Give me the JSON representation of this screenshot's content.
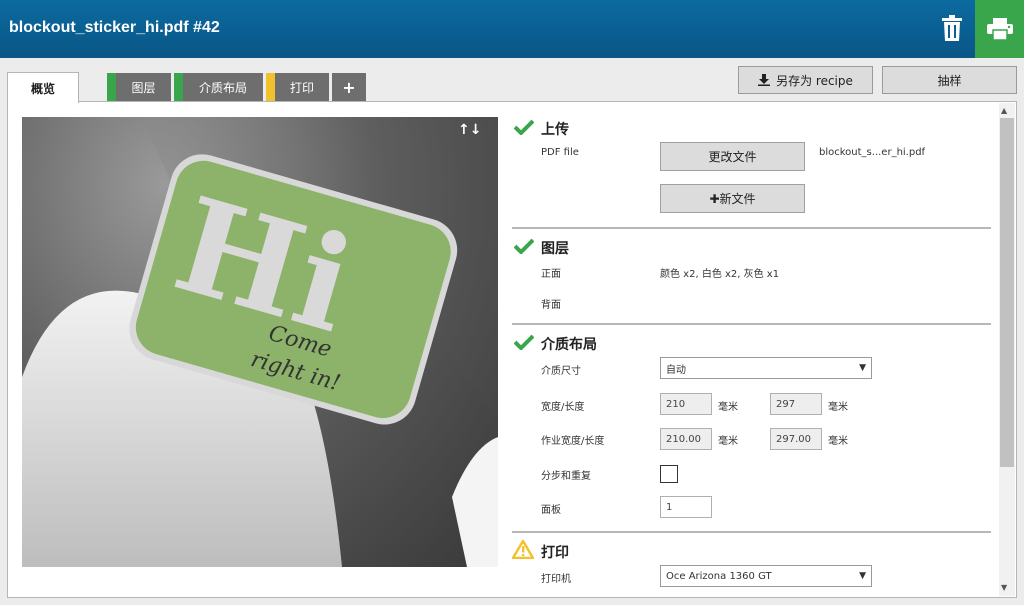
{
  "header": {
    "title": "blockout_sticker_hi.pdf #42",
    "trash_icon": "trash-icon",
    "print_icon": "printer-icon"
  },
  "tabs": [
    {
      "label": "概览",
      "active": true
    },
    {
      "label": "图层",
      "marker_color": "#3aa64c"
    },
    {
      "label": "介质布局",
      "marker_color": "#3aa64c"
    },
    {
      "label": "打印",
      "marker_color": "#f2c12e"
    },
    {
      "label": "+",
      "icon": "plus-icon"
    }
  ],
  "toolbar": {
    "save_recipe": "另存为 recipe",
    "sample": "抽样"
  },
  "preview": {
    "sticker_text": "Hi",
    "sticker_subtext_1": "Come",
    "sticker_subtext_2": "right in!",
    "arrows": "↑↓"
  },
  "sections": {
    "upload": {
      "title": "上传",
      "pdf_label": "PDF file",
      "change_file": "更改文件",
      "new_file": "新文件",
      "file_name": "blockout_s...er_hi.pdf"
    },
    "layers": {
      "title": "图层",
      "front_label": "正面",
      "front_value": "颜色 x2, 白色 x2, 灰色 x1",
      "back_label": "背面"
    },
    "media": {
      "title": "介质布局",
      "size_label": "介质尺寸",
      "size_value": "自动",
      "wh_label": "宽度/长度",
      "width": "210",
      "height": "297",
      "unit": "毫米",
      "job_wh_label": "作业宽度/长度",
      "job_width": "210.00",
      "job_height": "297.00",
      "step_repeat_label": "分步和重复",
      "panels_label": "面板",
      "panels_value": "1"
    },
    "print": {
      "title": "打印",
      "printer_label": "打印机",
      "printer_value": "Oce Arizona 1360 GT"
    }
  },
  "colors": {
    "header": "#0a5f93",
    "accent_green": "#3aa64c",
    "warning_yellow": "#f2c12e",
    "sticker_green": "#8db36a"
  }
}
